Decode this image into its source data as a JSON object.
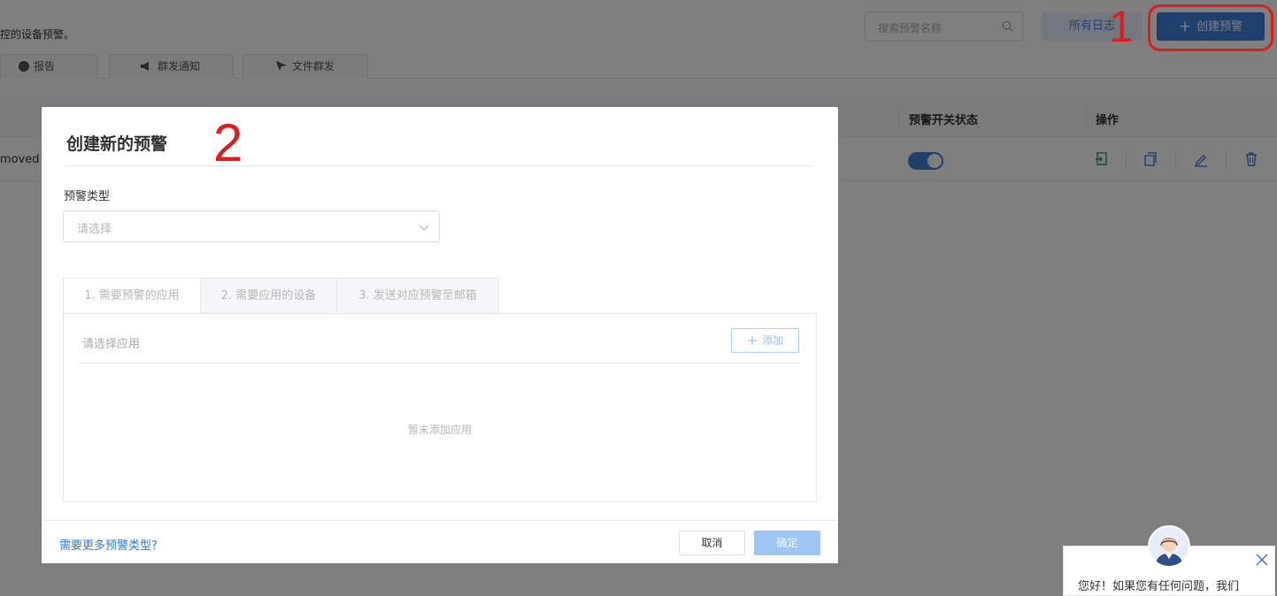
{
  "background": {
    "description_fragment": "控的设备预警。",
    "search": {
      "placeholder": "搜索预警名称"
    },
    "logs_button": "所有日志",
    "create_button": "创建预警",
    "annotation_1": "1",
    "tabs": [
      {
        "label": "报告",
        "icon": "info-icon"
      },
      {
        "label": "群发通知",
        "icon": "megaphone-icon"
      },
      {
        "label": "文件群发",
        "icon": "send-icon"
      }
    ],
    "table": {
      "headers": {
        "status": "预警开关状态",
        "actions": "操作"
      },
      "row": {
        "text_fragment": "moved",
        "status_on": true
      }
    }
  },
  "dialog": {
    "title": "创建新的预警",
    "annotation_2": "2",
    "type_label": "预警类型",
    "type_placeholder": "请选择",
    "steps": [
      {
        "label": "1. 需要预警的应用"
      },
      {
        "label": "2. 需要应用的设备"
      },
      {
        "label": "3. 发送对应预警至邮箱"
      }
    ],
    "panel": {
      "label": "请选择应用",
      "add_button": "添加",
      "empty_text": "暂未添加应用"
    },
    "footer": {
      "more_link": "需要更多预警类型?",
      "cancel": "取消",
      "confirm": "确定"
    }
  },
  "chat": {
    "message": "您好！如果您有任何问题，我们"
  },
  "colors": {
    "primary": "#3f7fd9",
    "annotation_red": "#e31b1b",
    "link": "#2e7bd8"
  }
}
